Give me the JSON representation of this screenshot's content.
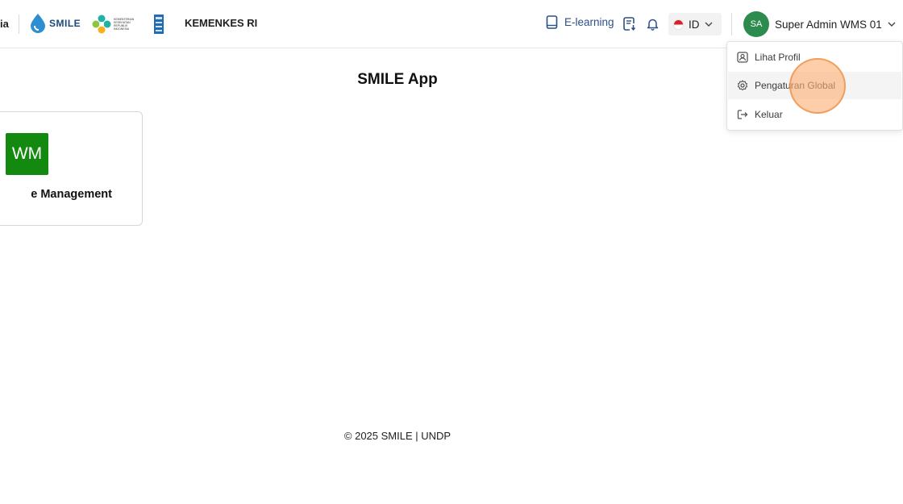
{
  "header": {
    "cut_text": "ia",
    "smile_logo_text": "SMILE",
    "kemenkes_logo_text": "KEMENTERIAN KESEHATAN REPUBLIK INDONESIA",
    "brand": "KEMENKES RI",
    "elearning_label": "E-learning",
    "language": "ID",
    "user_initials": "SA",
    "user_name": "Super Admin WMS 01"
  },
  "main": {
    "title": "SMILE App",
    "app_card": {
      "badge": "WM",
      "name": "e Management"
    }
  },
  "footer": {
    "text": "© 2025 SMILE | UNDP"
  },
  "user_menu": {
    "items": [
      {
        "label": "Lihat Profil",
        "icon": "profile-icon"
      },
      {
        "label": "Pengaturan Global",
        "icon": "gear-icon"
      },
      {
        "label": "Keluar",
        "icon": "logout-icon"
      }
    ]
  },
  "colors": {
    "accent": "#2c4f86",
    "avatar": "#2e8b4e",
    "app_badge": "#138a0f"
  }
}
